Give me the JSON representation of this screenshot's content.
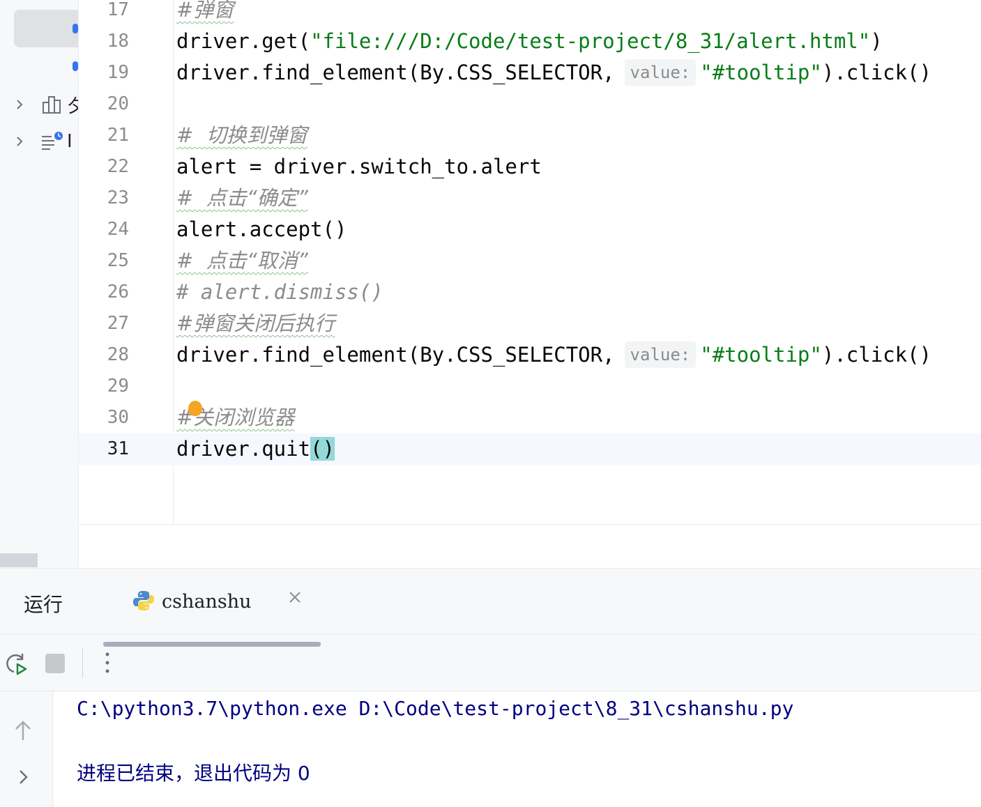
{
  "sidebar": {
    "items": [
      {
        "label": "夕",
        "icon": "bar-chart-icon"
      },
      {
        "label": "I",
        "icon": "list-clock-icon"
      }
    ]
  },
  "editor": {
    "lines": [
      {
        "n": "17",
        "segments": [
          {
            "t": "#弹窗",
            "c": "cmt"
          }
        ]
      },
      {
        "n": "18",
        "segments": [
          {
            "t": "driver.get(",
            "c": ""
          },
          {
            "t": "\"file:///D:/Code/test-project/8_31/alert.html\"",
            "c": "str"
          },
          {
            "t": ")",
            "c": ""
          }
        ]
      },
      {
        "n": "19",
        "segments": [
          {
            "t": "driver.find_element(By.CSS_SELECTOR,",
            "c": ""
          },
          {
            "t": "value:",
            "c": "hint"
          },
          {
            "t": "\"#tooltip\"",
            "c": "str"
          },
          {
            "t": ").click()",
            "c": ""
          }
        ]
      },
      {
        "n": "20",
        "segments": []
      },
      {
        "n": "21",
        "segments": [
          {
            "t": "#  切换到弹窗",
            "c": "cmt"
          }
        ]
      },
      {
        "n": "22",
        "segments": [
          {
            "t": "alert = driver.switch_to.alert",
            "c": ""
          }
        ]
      },
      {
        "n": "23",
        "segments": [
          {
            "t": "#  点击“确定”",
            "c": "cmt"
          }
        ]
      },
      {
        "n": "24",
        "segments": [
          {
            "t": "alert.accept()",
            "c": ""
          }
        ]
      },
      {
        "n": "25",
        "segments": [
          {
            "t": "#  点击“取消”",
            "c": "cmt"
          }
        ]
      },
      {
        "n": "26",
        "segments": [
          {
            "t": "# alert.dismiss()",
            "c": "cmt-mono"
          }
        ]
      },
      {
        "n": "27",
        "segments": [
          {
            "t": "#弹窗关闭后执行",
            "c": "cmt"
          }
        ]
      },
      {
        "n": "28",
        "segments": [
          {
            "t": "driver.find_element(By.CSS_SELECTOR,",
            "c": ""
          },
          {
            "t": "value:",
            "c": "hint"
          },
          {
            "t": "\"#tooltip\"",
            "c": "str"
          },
          {
            "t": ").click()",
            "c": ""
          }
        ]
      },
      {
        "n": "29",
        "segments": []
      },
      {
        "n": "30",
        "segments": [
          {
            "t": "#关闭浏览器",
            "c": "cmt"
          }
        ]
      },
      {
        "n": "31",
        "segments": [
          {
            "t": "driver.quit",
            "c": ""
          },
          {
            "t": "()",
            "c": "brace-hl"
          }
        ],
        "current": true
      }
    ]
  },
  "run": {
    "title": "运行",
    "tab_label": "cshanshu",
    "tab_icon": "python-icon",
    "console": [
      "C:\\python3.7\\python.exe D:\\Code\\test-project\\8_31\\cshanshu.py",
      "",
      "进程已结束，退出代码为 0"
    ]
  },
  "colors": {
    "string": "#067d17",
    "comment": "#8c8c8c",
    "console_text": "#000080",
    "brace_highlight": "#93d9d9",
    "current_line": "#f5f8fe"
  }
}
